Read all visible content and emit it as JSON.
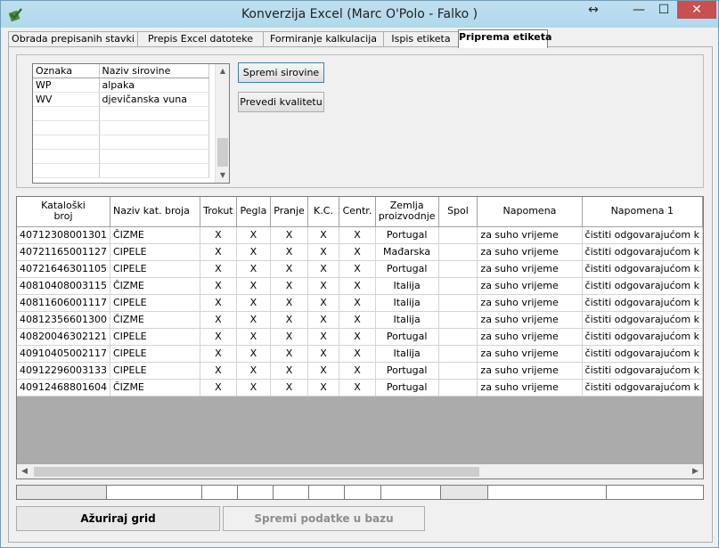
{
  "window": {
    "title": "Konverzija Excel (Marc O'Polo - Falko )",
    "controls": {
      "resize": "↔",
      "minimize": "—",
      "maximize": "☐",
      "close": "✕"
    }
  },
  "tabs": [
    {
      "label": "Obrada prepisanih stavki",
      "active": false
    },
    {
      "label": "Prepis Excel datoteke",
      "active": false
    },
    {
      "label": "Formiranje kalkulacija",
      "active": false
    },
    {
      "label": "Ispis etiketa",
      "active": false
    },
    {
      "label": "Priprema etiketa",
      "active": true
    }
  ],
  "materials": {
    "headers": [
      "Oznaka",
      "Naziv sirovine"
    ],
    "rows": [
      [
        "WP",
        "alpaka"
      ],
      [
        "WV",
        "djevičanska vuna"
      ],
      [
        "",
        ""
      ],
      [
        "",
        ""
      ],
      [
        "",
        ""
      ],
      [
        "",
        ""
      ],
      [
        "",
        ""
      ]
    ]
  },
  "buttons": {
    "save_materials": "Spremi sirovine",
    "translate_quality": "Prevedi kvalitetu",
    "update_grid": "Ažuriraj grid",
    "save_to_db": "Spremi podatke u bazu"
  },
  "grid": {
    "headers": [
      "Kataloški\nbroj",
      "Naziv kat. broja",
      "Trokut",
      "Pegla",
      "Pranje",
      "K.C.",
      "Centr.",
      "Zemlja\nproizvodnje",
      "Spol",
      "Napomena",
      "Napomena 1"
    ],
    "rows": [
      [
        "40712308001301",
        "ČIZME",
        "X",
        "X",
        "X",
        "X",
        "X",
        "Portugal",
        "",
        "za suho vrijeme",
        "čistiti odgovarajućom k"
      ],
      [
        "40721165001127",
        "CIPELE",
        "X",
        "X",
        "X",
        "X",
        "X",
        "Mađarska",
        "",
        "za suho vrijeme",
        "čistiti odgovarajućom k"
      ],
      [
        "40721646301105",
        "CIPELE",
        "X",
        "X",
        "X",
        "X",
        "X",
        "Portugal",
        "",
        "za suho vrijeme",
        "čistiti odgovarajućom k"
      ],
      [
        "40810408003115",
        "ČIZME",
        "X",
        "X",
        "X",
        "X",
        "X",
        "Italija",
        "",
        "za suho vrijeme",
        "čistiti odgovarajućom k"
      ],
      [
        "40811606001117",
        "CIPELE",
        "X",
        "X",
        "X",
        "X",
        "X",
        "Italija",
        "",
        "za suho vrijeme",
        "čistiti odgovarajućom k"
      ],
      [
        "40812356601300",
        "ČIZME",
        "X",
        "X",
        "X",
        "X",
        "X",
        "Italija",
        "",
        "za suho vrijeme",
        "čistiti odgovarajućom k"
      ],
      [
        "40820046302121",
        "CIPELE",
        "X",
        "X",
        "X",
        "X",
        "X",
        "Portugal",
        "",
        "za suho vrijeme",
        "čistiti odgovarajućom k"
      ],
      [
        "40910405002117",
        "CIPELE",
        "X",
        "X",
        "X",
        "X",
        "X",
        "Italija",
        "",
        "za suho vrijeme",
        "čistiti odgovarajućom k"
      ],
      [
        "40912296003133",
        "CIPELE",
        "X",
        "X",
        "X",
        "X",
        "X",
        "Portugal",
        "",
        "za suho vrijeme",
        "čistiti odgovarajućom k"
      ],
      [
        "40912468801604",
        "ČIZME",
        "X",
        "X",
        "X",
        "X",
        "X",
        "Portugal",
        "",
        "za suho vrijeme",
        "čistiti odgovarajućom k"
      ]
    ]
  },
  "icons": {
    "app": "excel-check-icon",
    "scroll_up": "▲",
    "scroll_down": "▼",
    "scroll_left": "◀",
    "scroll_right": "▶"
  },
  "colors": {
    "titlebar": "#b1d8ec",
    "close": "#c75050"
  }
}
